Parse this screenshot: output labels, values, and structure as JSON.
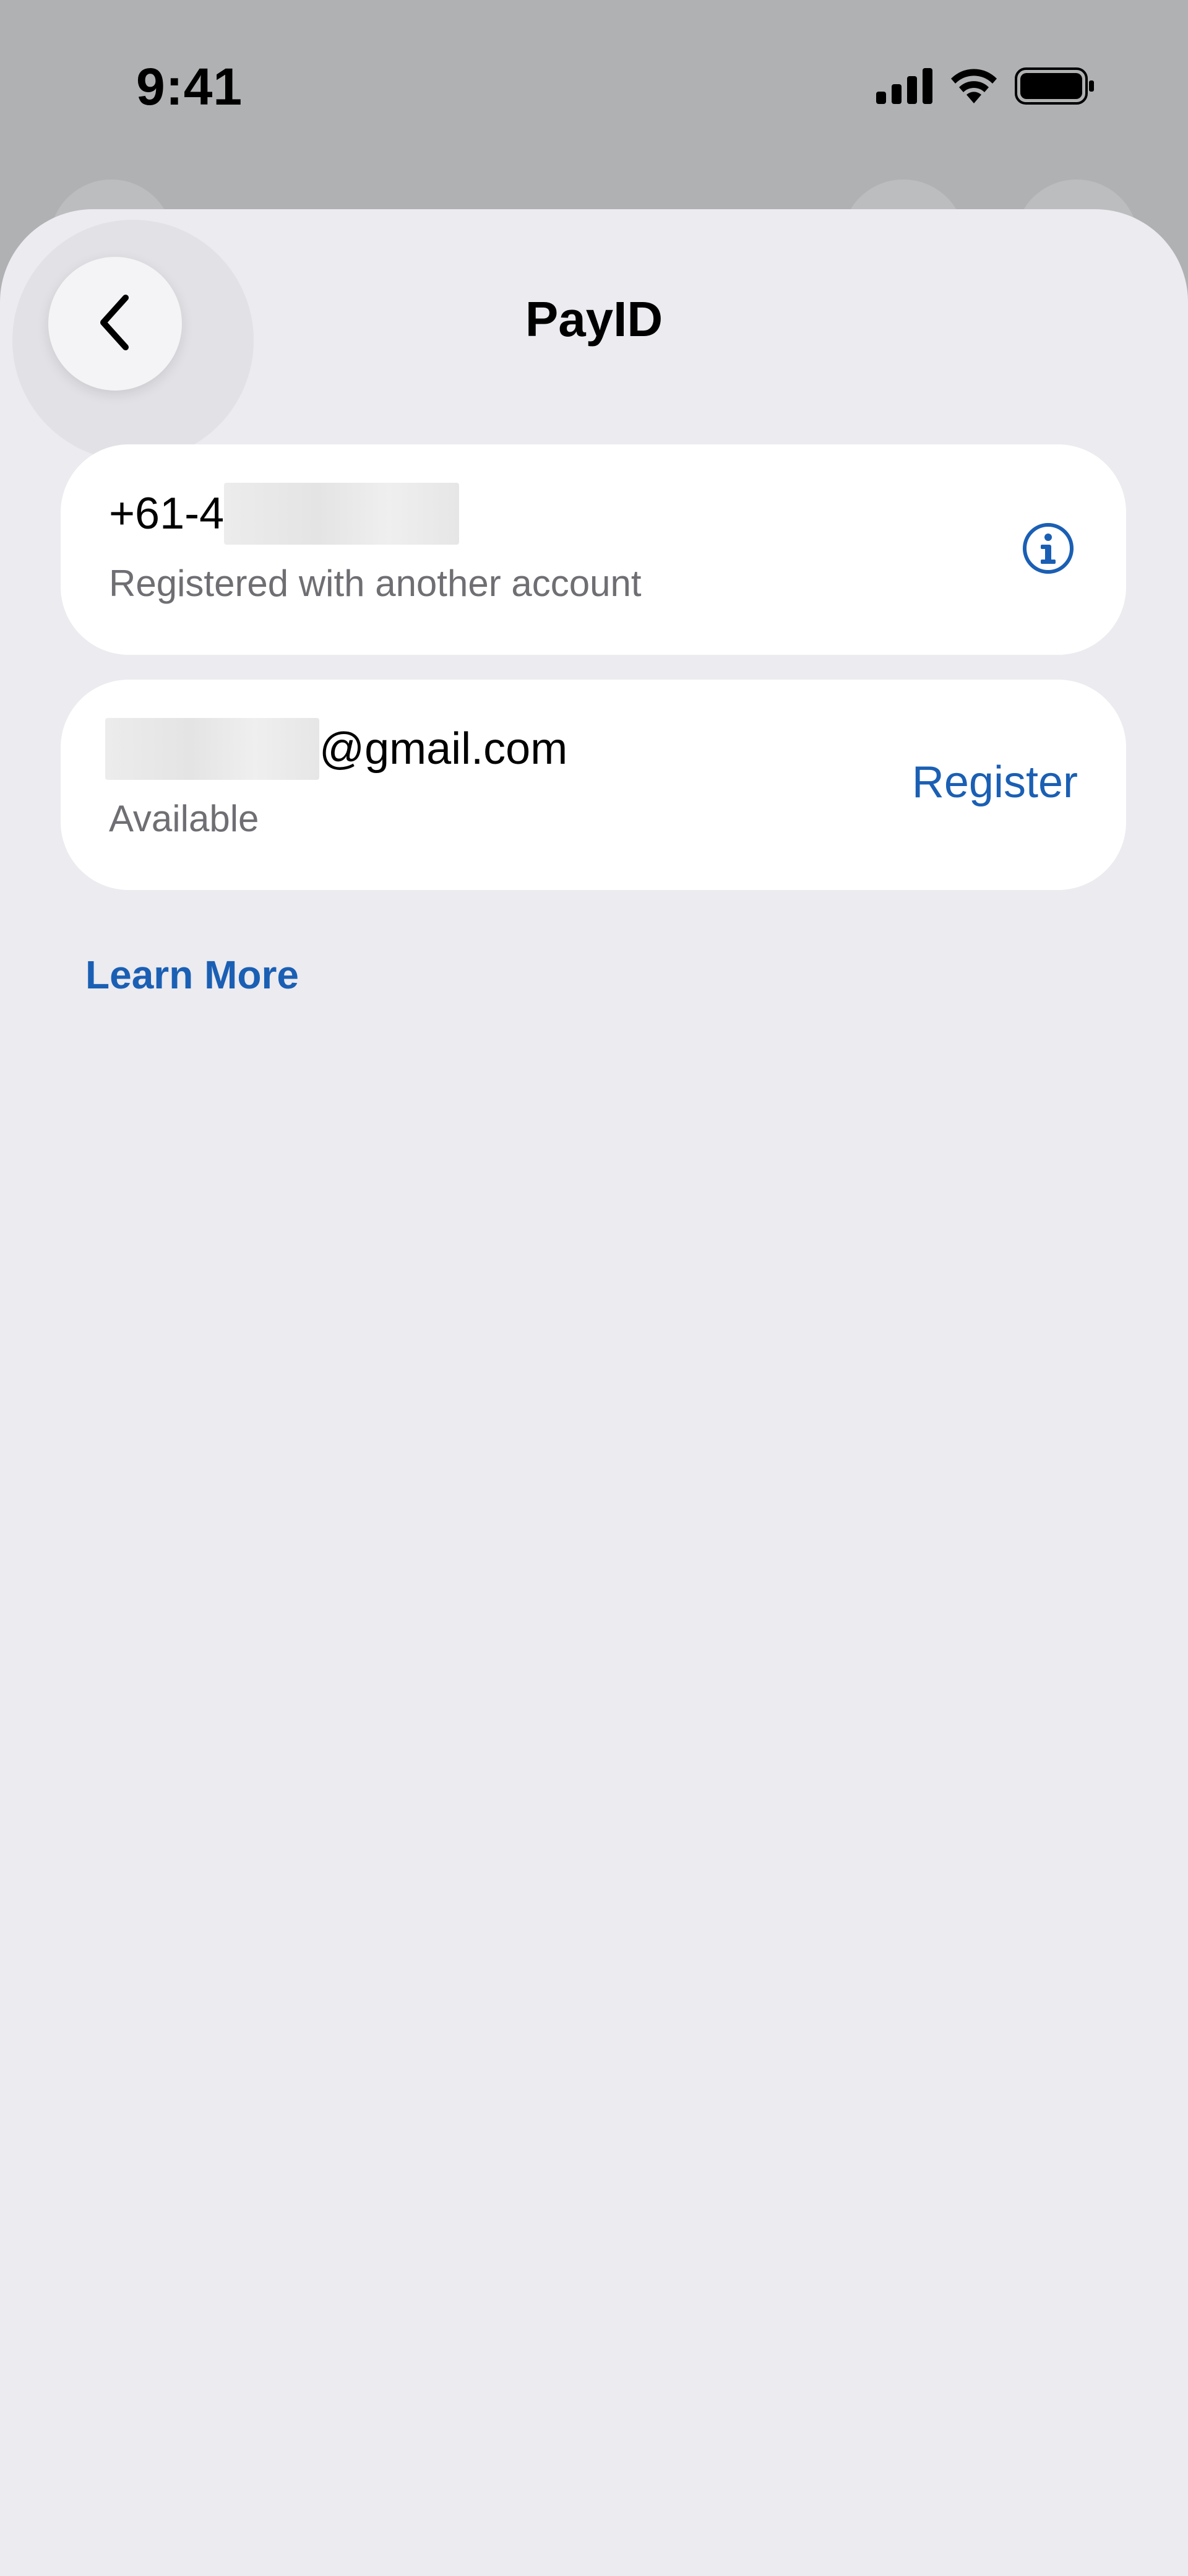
{
  "status_bar": {
    "time": "9:41",
    "icons": [
      "cellular-signal-icon",
      "wifi-icon",
      "battery-icon"
    ]
  },
  "header": {
    "title": "PayID",
    "back_icon": "chevron-left-icon"
  },
  "payids": [
    {
      "value_prefix": "+61-4",
      "value_suffix": "",
      "status": "Registered with another account",
      "action_icon": "info-icon"
    },
    {
      "value_prefix": "",
      "value_suffix": "@gmail.com",
      "status": "Available",
      "action_label": "Register"
    }
  ],
  "footer": {
    "learn_more_label": "Learn More"
  },
  "colors": {
    "accent": "#1a5fb4",
    "sheet_background": "#ebebf0",
    "card_background": "#ffffff",
    "secondary_text": "#6e6e73"
  }
}
